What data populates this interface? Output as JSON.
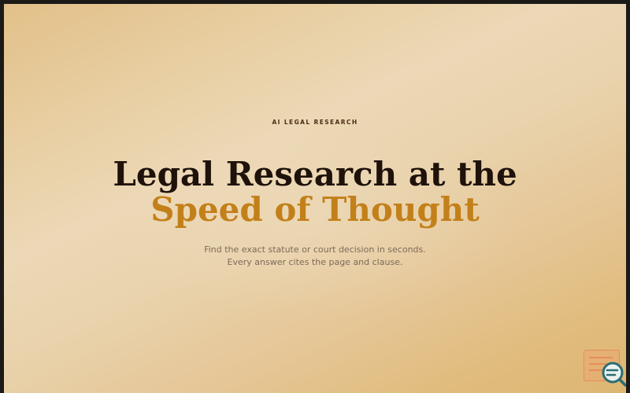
{
  "hero": {
    "eyebrow": "AI LEGAL RESEARCH",
    "headline_line1": "Legal Research at the",
    "headline_line2": "Speed of Thought",
    "subtitle": "Find the exact statute or court decision in seconds. Every answer cites the page and clause."
  },
  "widget": {
    "icon": "search-icon"
  },
  "colors": {
    "background_light": "#ecd8b6",
    "background_gold": "#ddb672",
    "headline_dark": "#1e120a",
    "headline_accent": "#c3801a",
    "eyebrow": "#4b2e18",
    "subtitle": "#7c6a5a",
    "widget_border": "#e88050",
    "fab_teal": "#2d6e73"
  }
}
